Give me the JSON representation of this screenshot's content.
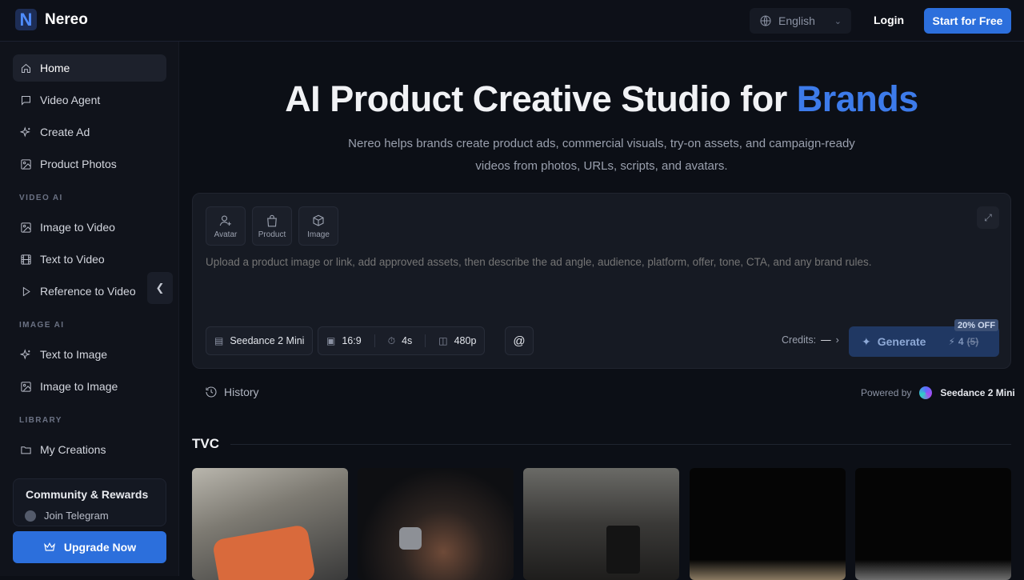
{
  "app": {
    "name": "Nereo",
    "logo_letter": "N"
  },
  "header": {
    "language": "English",
    "login_label": "Login",
    "start_label": "Start for Free"
  },
  "sidebar": {
    "items": [
      {
        "label": "Home",
        "icon": "home-icon",
        "active": true
      },
      {
        "label": "Video Agent",
        "icon": "chat-icon"
      },
      {
        "label": "Create Ad",
        "icon": "sparkle-icon"
      },
      {
        "label": "Product Photos",
        "icon": "image-icon"
      }
    ],
    "video_ai_label": "VIDEO AI",
    "video_items": [
      {
        "label": "Image to Video",
        "icon": "image-icon"
      },
      {
        "label": "Text to Video",
        "icon": "film-icon"
      },
      {
        "label": "Reference to Video",
        "icon": "play-icon"
      }
    ],
    "image_ai_label": "IMAGE AI",
    "image_items": [
      {
        "label": "Text to Image",
        "icon": "sparkle-icon"
      },
      {
        "label": "Image to Image",
        "icon": "image-icon"
      }
    ],
    "library_label": "LIBRARY",
    "library_items": [
      {
        "label": "My Creations",
        "icon": "folder-icon"
      }
    ],
    "community": {
      "title": "Community & Rewards",
      "item": "Join Telegram"
    },
    "upgrade_label": "Upgrade Now"
  },
  "hero": {
    "title_main": "AI Product Creative Studio for ",
    "title_accent": "Brands",
    "subtitle": "Nereo helps brands create product ads, commercial visuals, try-on assets, and campaign-ready videos from photos, URLs, scripts, and avatars."
  },
  "composer": {
    "assets": [
      {
        "label": "Avatar",
        "icon": "avatar-add-icon"
      },
      {
        "label": "Product",
        "icon": "bag-icon"
      },
      {
        "label": "Image",
        "icon": "box-add-icon"
      }
    ],
    "placeholder": "Upload a product image or link, add approved assets, then describe the ad angle, audience, platform, offer, tone, CTA, and any brand rules.",
    "model": "Seedance 2 Mini",
    "ratio": "16:9",
    "duration": "4s",
    "resolution": "480p",
    "mention": "@",
    "credits_label": "Credits:",
    "credits_value": "—",
    "generate_label": "Generate",
    "cost": "4",
    "cost_original": "(5)",
    "discount": "20% OFF"
  },
  "history_label": "History",
  "powered": {
    "label": "Powered by",
    "model": "Seedance 2 Mini"
  },
  "tvc": {
    "title": "TVC"
  },
  "colors": {
    "accent": "#2c6fdc",
    "title_accent": "#3d7bea",
    "bg": "#0c0f16"
  }
}
